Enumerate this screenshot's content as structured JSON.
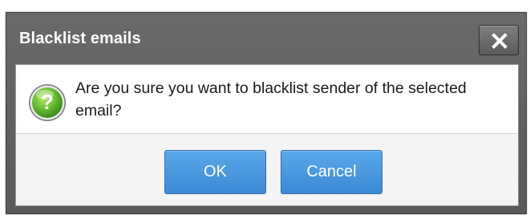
{
  "dialog": {
    "title": "Blacklist emails",
    "close_icon": "close-icon",
    "question_icon": "question-icon",
    "message": "Are you sure you want to blacklist sender of the selected email?",
    "buttons": {
      "ok_label": "OK",
      "cancel_label": "Cancel"
    },
    "colors": {
      "titlebar": "#5f5f5f",
      "button_primary": "#4a97df",
      "icon_green": "#5bb531"
    }
  }
}
